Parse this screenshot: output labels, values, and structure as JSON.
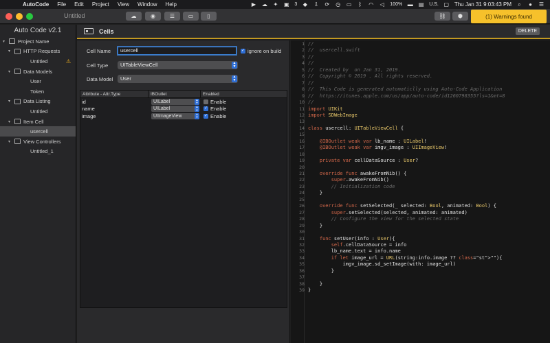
{
  "menubar": {
    "app_name": "AutoCode",
    "menus": [
      "File",
      "Edit",
      "Project",
      "View",
      "Window",
      "Help"
    ],
    "status": {
      "dropbox_count": "3",
      "battery": "100%",
      "input_source": "U.S.",
      "clock": "Thu Jan 31  9:03:43 PM"
    }
  },
  "window": {
    "title": "Untitled",
    "warning_button": "(1) Warnings found"
  },
  "sidebar": {
    "title": "Auto Code v2.1",
    "tree": [
      {
        "label": "Project Name",
        "level": 0,
        "expander": "▾",
        "icon": "project-icon"
      },
      {
        "label": "HTTP Requests",
        "level": 1,
        "expander": "▾",
        "icon": "network-icon"
      },
      {
        "label": "Untitled",
        "level": 2,
        "expander": "",
        "icon": "",
        "warning": true
      },
      {
        "label": "Data Models",
        "level": 1,
        "expander": "▾",
        "icon": "model-icon"
      },
      {
        "label": "User",
        "level": 2,
        "expander": "",
        "icon": ""
      },
      {
        "label": "Token",
        "level": 2,
        "expander": "",
        "icon": ""
      },
      {
        "label": "Data Listing",
        "level": 1,
        "expander": "▾",
        "icon": "list-icon"
      },
      {
        "label": "Untitled",
        "level": 2,
        "expander": "",
        "icon": ""
      },
      {
        "label": "Item Cell",
        "level": 1,
        "expander": "▾",
        "icon": "cell-icon"
      },
      {
        "label": "usercell",
        "level": 2,
        "expander": "",
        "icon": "",
        "selected": true
      },
      {
        "label": "View Controllers",
        "level": 1,
        "expander": "▾",
        "icon": "phone-icon"
      },
      {
        "label": "Untitled_1",
        "level": 2,
        "expander": "",
        "icon": ""
      }
    ]
  },
  "cells": {
    "title": "Cells",
    "delete_label": "DELETE",
    "cell_name_label": "Cell Name",
    "cell_name_value": "usercell",
    "ignore_label": "ignore on build",
    "ignore_checked": true,
    "cell_type_label": "Cell Type",
    "cell_type_value": "UITableViewCell",
    "data_model_label": "Data Model",
    "data_model_value": "User",
    "table": {
      "headers": [
        "Attribute - Attr.Type",
        "IBOutlet",
        "Enabled"
      ],
      "rows": [
        {
          "attr": "id",
          "outlet": "UILabel",
          "enabled_label": "Enable",
          "enabled": false
        },
        {
          "attr": "name",
          "outlet": "UILabel",
          "enabled_label": "Enable",
          "enabled": true
        },
        {
          "attr": "image",
          "outlet": "UIImageView",
          "enabled_label": "Enable",
          "enabled": true
        }
      ]
    }
  },
  "code": {
    "lines": [
      "//",
      "//  usercell.swift",
      "//",
      "//",
      "//  Created by  on Jan 31, 2019.",
      "//  Copyright © 2019 . All rights reserved.",
      "//",
      "//  This Code is generated automaticlly using Auto-Code Application",
      "//  https://itunes.apple.com/us/app/auto-code/id1260798355?ls=1&mt=8",
      "//",
      "import UIKit",
      "import SDWebImage",
      "",
      "class usercell: UITableViewCell {",
      "",
      "    @IBOutlet weak var lb_name : UILabel!",
      "    @IBOutlet weak var imgv_image : UIImageView!",
      "",
      "    private var cellDataSource : User?",
      "",
      "    override func awakeFromNib() {",
      "        super.awakeFromNib()",
      "        // Initialization code",
      "    }",
      "",
      "    override func setSelected(_ selected: Bool, animated: Bool) {",
      "        super.setSelected(selected, animated: animated)",
      "        // Configure the view for the selected state",
      "    }",
      "",
      "    func setUser(info : User){",
      "        self.cellDataSource = info",
      "        lb_name.text = info.name",
      "        if let image_url = URL(string:info.image ?? \"\"){",
      "            imgv_image.sd_setImage(with: image_url)",
      "        }",
      "",
      "    }",
      "}"
    ]
  }
}
